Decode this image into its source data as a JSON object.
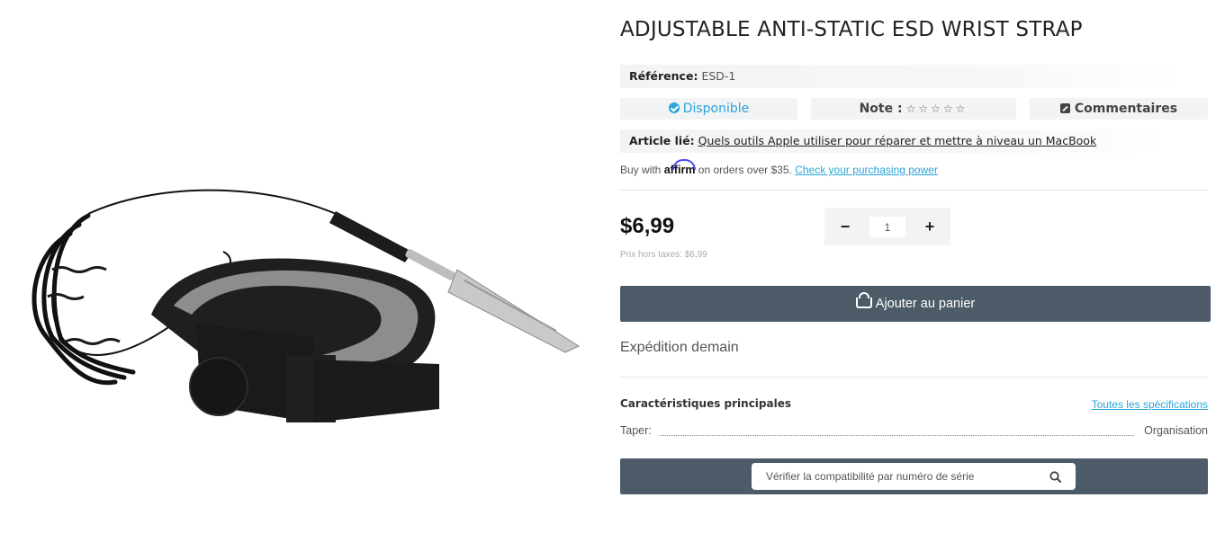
{
  "product": {
    "title": "ADJUSTABLE ANTI-STATIC ESD WRIST STRAP",
    "image_icon": "esd-wrist-strap-photo",
    "reference_label": "Référence:",
    "reference_value": "ESD-1"
  },
  "status": {
    "availability": "Disponible",
    "rating_label": "Note :",
    "rating_stars": "☆☆☆☆☆",
    "rating_value": 0,
    "rating_max": 5,
    "comments_label": "Commentaires"
  },
  "related": {
    "label": "Article lié:",
    "link_text": "Quels outils Apple utiliser pour réparer et mettre à niveau un MacBook"
  },
  "affirm": {
    "prefix": "Buy with",
    "logo": "affirm",
    "suffix": "on orders over $35.",
    "link_text": "Check your purchasing power"
  },
  "pricing": {
    "price": "$6,99",
    "price_excl_tax": "Prix hors taxes: $6,99"
  },
  "quantity": {
    "minus": "−",
    "value": "1",
    "plus": "+"
  },
  "cart": {
    "button_label": "Ajouter au panier",
    "icon": "basket-icon"
  },
  "shipping": {
    "text": "Expédition demain"
  },
  "specs": {
    "title": "Caractéristiques principales",
    "all_link": "Toutes les spécifications",
    "rows": [
      {
        "key": "Taper:",
        "value": "Organisation"
      }
    ]
  },
  "serial_search": {
    "placeholder": "Vérifier la compatibilité par numéro de série",
    "icon": "search-icon"
  },
  "colors": {
    "accent": "#2aa5d8",
    "button_bg": "#4d5b69",
    "panel_bg": "#f2f3f5"
  }
}
